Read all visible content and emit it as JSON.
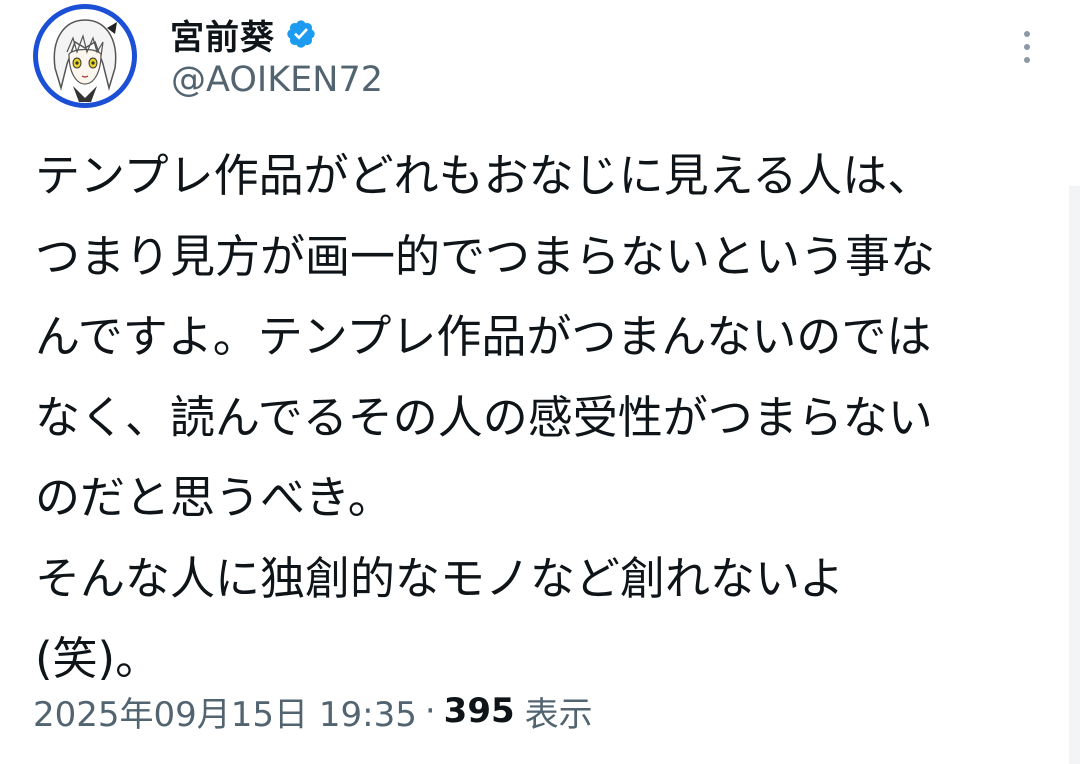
{
  "author": {
    "display_name": "宮前葵",
    "handle": "@AOIKEN72",
    "verified": true
  },
  "tweet": {
    "lines": [
      "テンプレ作品がどれもおなじに見える人は、",
      "つまり見方が画一的でつまらないという事な",
      "んですよ。テンプレ作品がつまんないのでは",
      "なく、読んでるその人の感受性がつまらない",
      "のだと思うべき。",
      "そんな人に独創的なモノなど創れないよ",
      "(笑)。"
    ]
  },
  "meta": {
    "timestamp": "2025年09月15日 19:35",
    "separator": "·",
    "views_count": "395",
    "views_label": "表示"
  },
  "colors": {
    "text": "#0f1419",
    "secondary": "#536471",
    "verified_badge": "#1d9bf0",
    "avatar_ring": "#1b4fd6"
  },
  "icons": {
    "verified": "verified-badge-icon",
    "more": "more-vertical-icon"
  }
}
